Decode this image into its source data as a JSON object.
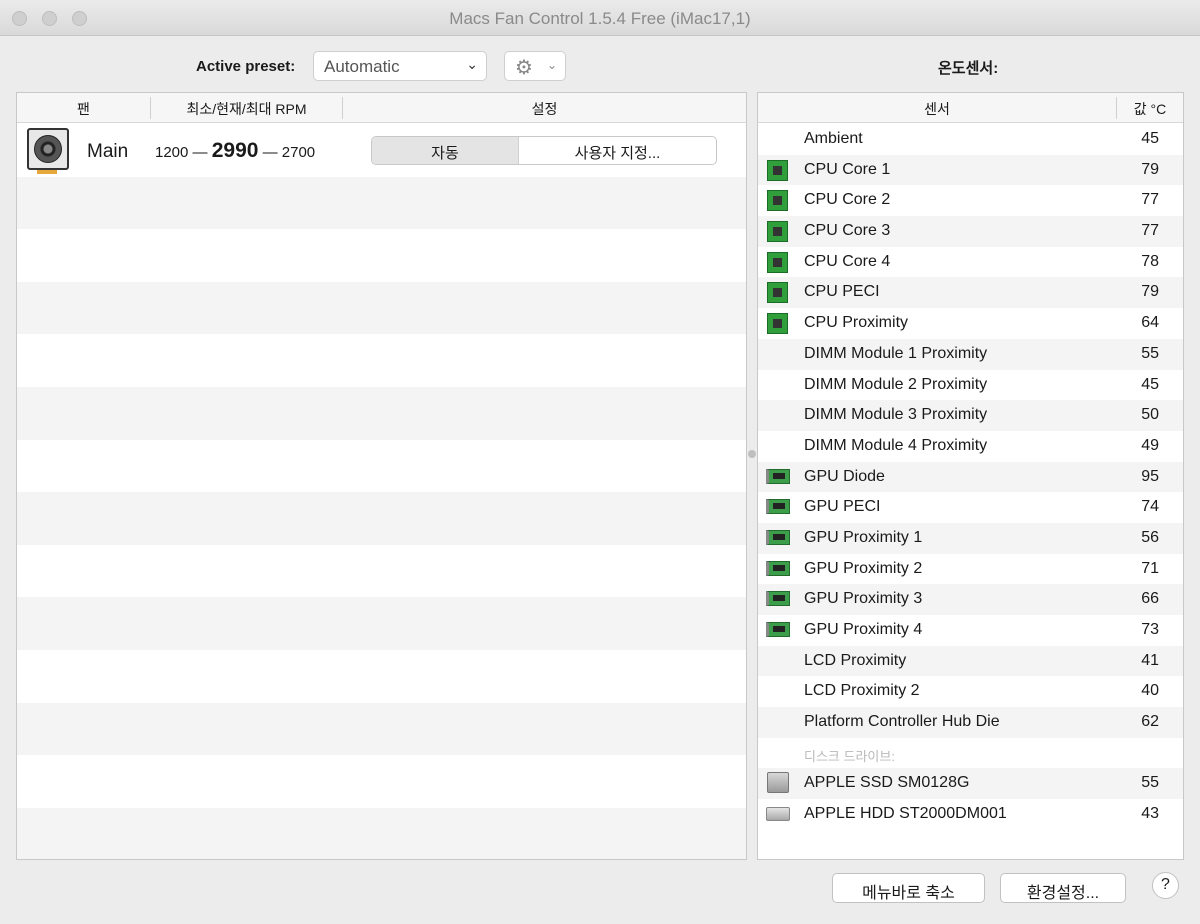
{
  "window": {
    "title": "Macs Fan Control 1.5.4 Free (iMac17,1)"
  },
  "toolbar": {
    "preset_label": "Active preset:",
    "preset_value": "Automatic",
    "sensors_title": "온도센서:"
  },
  "fan_table": {
    "headers": {
      "fan": "팬",
      "rpm": "최소/현재/최대 RPM",
      "settings": "설정"
    },
    "fans": [
      {
        "name": "Main",
        "min_rpm": "1200",
        "current_rpm": "2990",
        "max_rpm": "2700",
        "dash": "—",
        "mode_auto": "자동",
        "mode_custom": "사용자 지정..."
      }
    ]
  },
  "sensor_table": {
    "headers": {
      "sensor": "센서",
      "value": "값 °C"
    },
    "rows": [
      {
        "icon": "none",
        "name": "Ambient",
        "value": "45"
      },
      {
        "icon": "cpu-icon",
        "name": "CPU Core 1",
        "value": "79"
      },
      {
        "icon": "cpu-icon",
        "name": "CPU Core 2",
        "value": "77"
      },
      {
        "icon": "cpu-icon",
        "name": "CPU Core 3",
        "value": "77"
      },
      {
        "icon": "cpu-icon",
        "name": "CPU Core 4",
        "value": "78"
      },
      {
        "icon": "cpu-icon",
        "name": "CPU PECI",
        "value": "79"
      },
      {
        "icon": "cpu-icon",
        "name": "CPU Proximity",
        "value": "64"
      },
      {
        "icon": "none",
        "name": "DIMM Module 1 Proximity",
        "value": "55"
      },
      {
        "icon": "none",
        "name": "DIMM Module 2 Proximity",
        "value": "45"
      },
      {
        "icon": "none",
        "name": "DIMM Module 3 Proximity",
        "value": "50"
      },
      {
        "icon": "none",
        "name": "DIMM Module 4 Proximity",
        "value": "49"
      },
      {
        "icon": "gpu-icon",
        "name": "GPU Diode",
        "value": "95"
      },
      {
        "icon": "gpu-icon",
        "name": "GPU PECI",
        "value": "74"
      },
      {
        "icon": "gpu-icon",
        "name": "GPU Proximity 1",
        "value": "56"
      },
      {
        "icon": "gpu-icon",
        "name": "GPU Proximity 2",
        "value": "71"
      },
      {
        "icon": "gpu-icon",
        "name": "GPU Proximity 3",
        "value": "66"
      },
      {
        "icon": "gpu-icon",
        "name": "GPU Proximity 4",
        "value": "73"
      },
      {
        "icon": "none",
        "name": "LCD Proximity",
        "value": "41"
      },
      {
        "icon": "none",
        "name": "LCD Proximity 2",
        "value": "40"
      },
      {
        "icon": "none",
        "name": "Platform Controller Hub Die",
        "value": "62"
      },
      {
        "icon": "section",
        "name": "디스크 드라이브:",
        "value": ""
      },
      {
        "icon": "ssd-icon",
        "name": "APPLE SSD SM0128G",
        "value": "55"
      },
      {
        "icon": "hdd-icon",
        "name": "APPLE HDD ST2000DM001",
        "value": "43"
      }
    ]
  },
  "footer": {
    "menubar_button": "메뉴바로 축소",
    "preferences_button": "환경설정...",
    "help_button": "?"
  }
}
